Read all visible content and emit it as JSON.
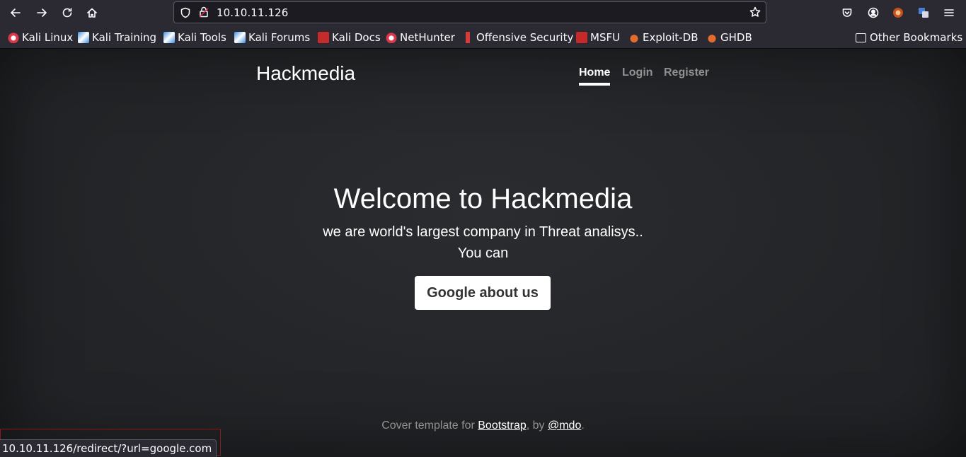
{
  "browser": {
    "url": "10.10.11.126",
    "bookmarks": [
      {
        "label": "Kali Linux",
        "icon": "kali-icon"
      },
      {
        "label": "Kali Training",
        "icon": "kali-training-icon"
      },
      {
        "label": "Kali Tools",
        "icon": "kali-tools-icon"
      },
      {
        "label": "Kali Forums",
        "icon": "kali-forums-icon"
      },
      {
        "label": "Kali Docs",
        "icon": "kali-docs-icon"
      },
      {
        "label": "NetHunter",
        "icon": "nethunter-icon"
      },
      {
        "label": "Offensive Security",
        "icon": "offsec-icon"
      },
      {
        "label": "MSFU",
        "icon": "msfu-icon"
      },
      {
        "label": "Exploit-DB",
        "icon": "exploit-db-icon"
      },
      {
        "label": "GHDB",
        "icon": "ghdb-icon"
      }
    ],
    "other_bookmarks": "Other Bookmarks",
    "status_url": "10.10.11.126/redirect/?url=google.com"
  },
  "site": {
    "brand": "Hackmedia",
    "nav": {
      "home": "Home",
      "login": "Login",
      "register": "Register"
    },
    "hero": {
      "title": "Welcome to Hackmedia",
      "line1": "we are world's largest company in Threat analisys..",
      "line2": "You can",
      "button": "Google about us"
    },
    "footer": {
      "prefix": "Cover template for ",
      "bootstrap": "Bootstrap",
      "middle": ", by ",
      "author": "@mdo",
      "suffix": "."
    }
  },
  "colors": {
    "chrome": "#2b2a33",
    "page_bg": "#232528",
    "button_bg": "#ffffff",
    "status_outline": "#8b1a1a"
  }
}
